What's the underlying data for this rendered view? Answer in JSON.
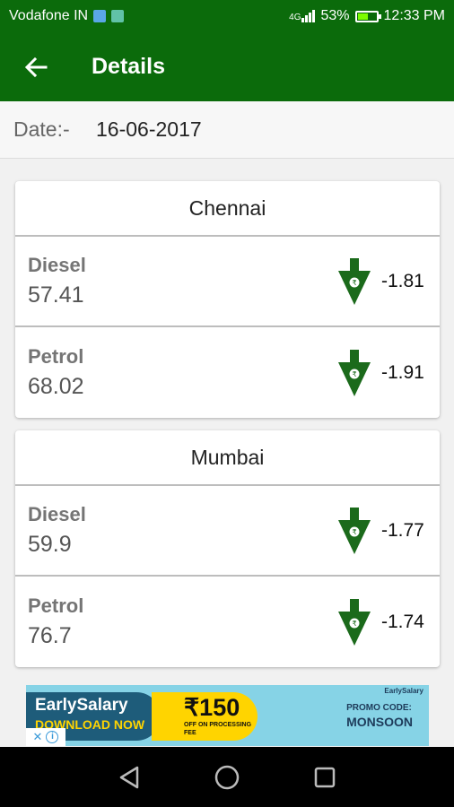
{
  "status_bar": {
    "carrier": "Vodafone IN",
    "network": "4G",
    "battery": "53%",
    "battery_level": 0.53,
    "time": "12:33 PM"
  },
  "app_bar": {
    "title": "Details"
  },
  "date": {
    "label": "Date:-",
    "value": "16-06-2017"
  },
  "colors": {
    "primary": "#0b6b0b",
    "arrow": "#1b6a1b",
    "divider": "#bdbdbd"
  },
  "cities": [
    {
      "name": "Chennai",
      "fuels": [
        {
          "name": "Diesel",
          "price": "57.41",
          "change": "-1.81",
          "trend_icon": "price-down-icon"
        },
        {
          "name": "Petrol",
          "price": "68.02",
          "change": "-1.91",
          "trend_icon": "price-down-icon"
        }
      ]
    },
    {
      "name": "Mumbai",
      "fuels": [
        {
          "name": "Diesel",
          "price": "59.9",
          "change": "-1.77",
          "trend_icon": "price-down-icon"
        },
        {
          "name": "Petrol",
          "price": "76.7",
          "change": "-1.74",
          "trend_icon": "price-down-icon"
        }
      ]
    }
  ],
  "ad": {
    "brand": "EarlySalary",
    "cta": "DOWNLOAD NOW",
    "amount": "₹150",
    "offer": "OFF ON PROCESSING FEE",
    "tag": "EarlySalary",
    "promo_label": "PROMO CODE:",
    "promo_code": "MONSOON"
  },
  "nav": {
    "back": "back-triangle-icon",
    "home": "home-circle-icon",
    "recents": "recents-square-icon"
  }
}
